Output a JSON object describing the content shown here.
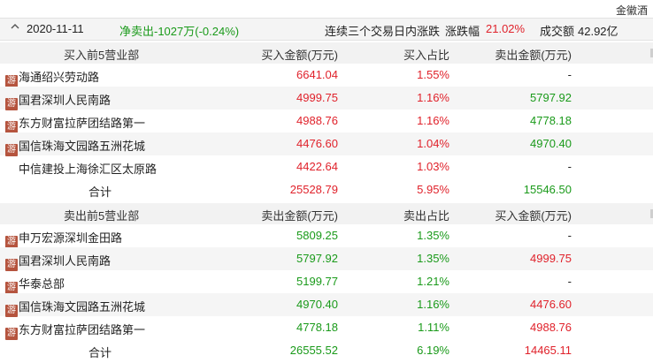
{
  "header": {
    "stock_name": "金徽酒",
    "date": "2020-11-11",
    "net_sell": "净卖出-1027万(-0.24%)",
    "reason": "连续三个交易日内涨跌",
    "change_label": "涨跌幅",
    "change_value": "21.02%",
    "volume_label": "成交额",
    "volume_value": "42.92亿"
  },
  "buy": {
    "headers": [
      "买入前5营业部",
      "买入金额(万元)",
      "买入占比",
      "卖出金额(万元)"
    ],
    "rows": [
      {
        "name": "海通绍兴劳动路",
        "a": "6641.04",
        "b": "1.55%",
        "c": "-",
        "badge": "游"
      },
      {
        "name": "国君深圳人民南路",
        "a": "4999.75",
        "b": "1.16%",
        "c": "5797.92",
        "badge": "游"
      },
      {
        "name": "东方财富拉萨团结路第一",
        "a": "4988.76",
        "b": "1.16%",
        "c": "4778.18",
        "badge": "游"
      },
      {
        "name": "国信珠海文园路五洲花城",
        "a": "4476.60",
        "b": "1.04%",
        "c": "4970.40",
        "badge": "游"
      },
      {
        "name": "中信建投上海徐汇区太原路",
        "a": "4422.64",
        "b": "1.03%",
        "c": "-",
        "badge": ""
      }
    ],
    "total": {
      "label": "合计",
      "a": "25528.79",
      "b": "5.95%",
      "c": "15546.50"
    }
  },
  "sell": {
    "headers": [
      "卖出前5营业部",
      "卖出金额(万元)",
      "卖出占比",
      "买入金额(万元)"
    ],
    "rows": [
      {
        "name": "申万宏源深圳金田路",
        "a": "5809.25",
        "b": "1.35%",
        "c": "-",
        "badge": "游"
      },
      {
        "name": "国君深圳人民南路",
        "a": "5797.92",
        "b": "1.35%",
        "c": "4999.75",
        "badge": "游"
      },
      {
        "name": "华泰总部",
        "a": "5199.77",
        "b": "1.21%",
        "c": "-",
        "badge": "游"
      },
      {
        "name": "国信珠海文园路五洲花城",
        "a": "4970.40",
        "b": "1.16%",
        "c": "4476.60",
        "badge": "游"
      },
      {
        "name": "东方财富拉萨团结路第一",
        "a": "4778.18",
        "b": "1.11%",
        "c": "4988.76",
        "badge": "游"
      }
    ],
    "total": {
      "label": "合计",
      "a": "26555.52",
      "b": "6.19%",
      "c": "14465.11"
    }
  },
  "colors": {
    "red": "#e0222b",
    "green": "#1a9a1a",
    "badge": "#b5543e"
  },
  "icons": {
    "collapse": "chevron-up-icon",
    "badge": "hot-money-badge"
  }
}
